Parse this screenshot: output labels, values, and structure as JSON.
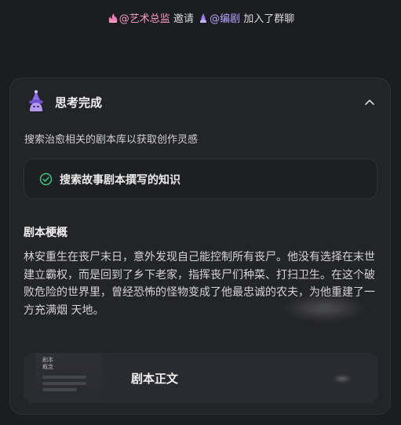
{
  "invite": {
    "art_mention": "@艺术总监",
    "verb": "邀请",
    "writer_mention": "@编剧",
    "suffix": "加入了群聊"
  },
  "thinking_card": {
    "title": "思考完成",
    "subtitle": "搜索治愈相关的剧本库以获取创作灵感",
    "step_label": "搜索故事剧本撰写的知识",
    "synopsis_title": "剧本梗概",
    "synopsis_text": "林安重生在丧尸末日，意外发现自己能控制所有丧尸。他没有选择在末世建立霸权，而是回到了乡下老家，指挥丧尸们种菜、打扫卫生。在这个破败危险的世界里，曾经恐怖的怪物变成了他最忠诚的农夫，为他重建了一方充满烟 天地。",
    "doc_thumb_label": "剧本概念",
    "doc_title": "剧本正文"
  },
  "icons": {
    "art_icon": "pink-flame-icon",
    "writer_icon": "purple-flame-icon",
    "avatar_icon": "purple-wizard-icon",
    "collapse_icon": "chevron-up-icon",
    "step_icon": "check-circle-icon"
  },
  "colors": {
    "background": "#1c1d21",
    "card": "#232428",
    "mention_art": "#f59ac8",
    "mention_writer": "#b9a3ff",
    "check_green": "#3cc47c"
  }
}
